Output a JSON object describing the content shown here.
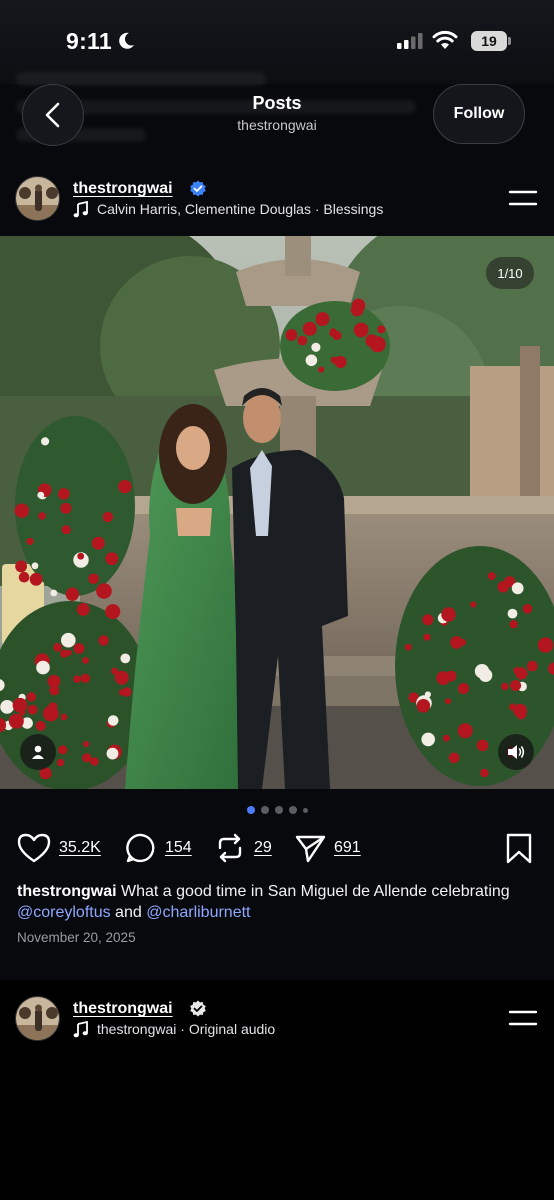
{
  "status_bar": {
    "time": "9:11",
    "battery": "19"
  },
  "header": {
    "title": "Posts",
    "subtitle": "thestrongwai",
    "follow_label": "Follow"
  },
  "post1": {
    "username": "thestrongwai",
    "audio": "Calvin Harris, Clementine Douglas · Blessings",
    "photo_counter": "1/10",
    "likes": "35.2K",
    "comments": "154",
    "reposts": "29",
    "shares": "691",
    "caption_user": "thestrongwai",
    "caption_text": " What a good time in San Miguel de Allende celebrating ",
    "mention1": "@coreyloftus",
    "caption_and": " and ",
    "mention2": "@charliburnett",
    "date": "November 20, 2025",
    "carousel_active_index": 1,
    "carousel_dots": 5
  },
  "post2": {
    "username": "thestrongwai",
    "audio": "thestrongwai · Original audio"
  },
  "colors": {
    "accent": "#4d7bff",
    "mention": "#8fa6ff",
    "verified": "#3b82f6"
  },
  "icons": [
    "moon-icon",
    "signal-icon",
    "wifi-icon",
    "back-arrow-icon",
    "verified-icon",
    "music-note-icon",
    "menu-icon",
    "user-tag-icon",
    "speaker-icon",
    "heart-icon",
    "comment-icon",
    "repost-icon",
    "share-icon",
    "bookmark-icon"
  ]
}
